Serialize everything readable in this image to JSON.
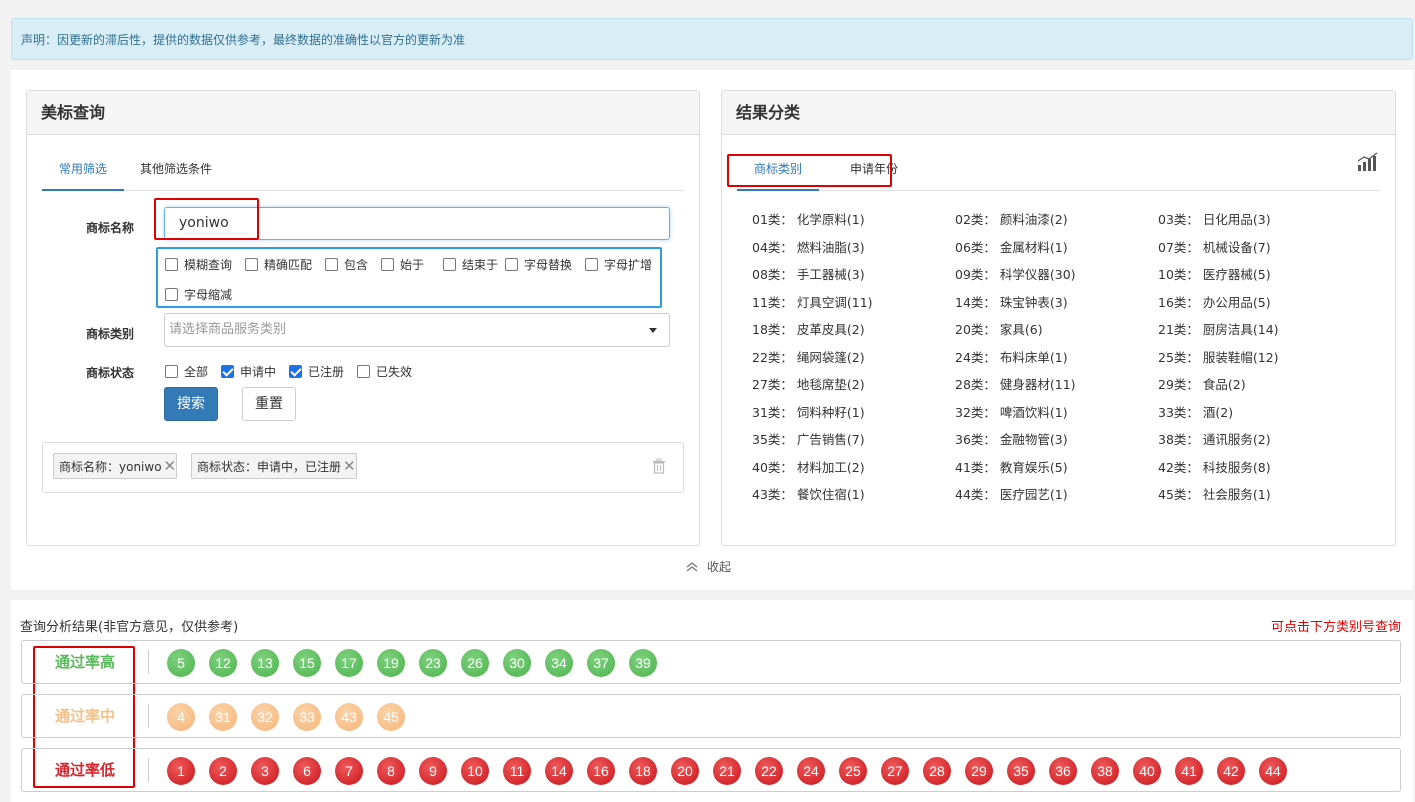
{
  "notice": "声明：因更新的滞后性，提供的数据仅供参考，最终数据的准确性以官方的更新为准",
  "query_panel": {
    "title": "美标查询",
    "tabs": [
      "常用筛选",
      "其他筛选条件"
    ],
    "name_label": "商标名称",
    "name_value": "yoniwo",
    "match_options": [
      {
        "label": "模糊查询",
        "checked": false
      },
      {
        "label": "精确匹配",
        "checked": false
      },
      {
        "label": "包含",
        "checked": false
      },
      {
        "label": "始于",
        "checked": false
      },
      {
        "label": "结束于",
        "checked": false
      },
      {
        "label": "字母替换",
        "checked": false
      },
      {
        "label": "字母扩增",
        "checked": false
      },
      {
        "label": "字母缩减",
        "checked": false
      }
    ],
    "category_label": "商标类别",
    "category_placeholder": "请选择商品服务类别",
    "status_label": "商标状态",
    "status_options": [
      {
        "label": "全部",
        "checked": false
      },
      {
        "label": "申请中",
        "checked": true
      },
      {
        "label": "已注册",
        "checked": true
      },
      {
        "label": "已失效",
        "checked": false
      }
    ],
    "search_button": "搜索",
    "reset_button": "重置",
    "filter_chips": [
      "商标名称：yoniwo",
      "商标状态：申请中，已注册"
    ]
  },
  "result_panel": {
    "title": "结果分类",
    "tabs": [
      "商标类别",
      "申请年份"
    ],
    "classes": [
      "01类： 化学原料(1)",
      "02类： 颜料油漆(2)",
      "03类： 日化用品(3)",
      "04类： 燃料油脂(3)",
      "06类： 金属材料(1)",
      "07类： 机械设备(7)",
      "08类： 手工器械(3)",
      "09类： 科学仪器(30)",
      "10类： 医疗器械(5)",
      "11类： 灯具空调(11)",
      "14类： 珠宝钟表(3)",
      "16类： 办公用品(5)",
      "18类： 皮革皮具(2)",
      "20类： 家具(6)",
      "21类： 厨房洁具(14)",
      "22类： 绳网袋篷(2)",
      "24类： 布料床单(1)",
      "25类： 服装鞋帽(12)",
      "27类： 地毯席垫(2)",
      "28类： 健身器材(11)",
      "29类： 食品(2)",
      "31类： 饲料种籽(1)",
      "32类： 啤酒饮料(1)",
      "33类： 酒(2)",
      "35类： 广告销售(7)",
      "36类： 金融物管(3)",
      "38类： 通讯服务(2)",
      "40类： 材料加工(2)",
      "41类： 教育娱乐(5)",
      "42类： 科技服务(8)",
      "43类： 餐饮住宿(1)",
      "44类： 医疗园艺(1)",
      "45类： 社会服务(1)"
    ]
  },
  "collapse_label": "收起",
  "analysis": {
    "title": "查询分析结果(非官方意见，仅供参考)",
    "hint": "可点击下方类别号查询",
    "rows": [
      {
        "label": "通过率高",
        "level": "high",
        "color": "#5cb85c",
        "classes": [
          "5",
          "12",
          "13",
          "15",
          "17",
          "19",
          "23",
          "26",
          "30",
          "34",
          "37",
          "39"
        ]
      },
      {
        "label": "通过率中",
        "level": "mid",
        "color": "#f5c18a",
        "classes": [
          "4",
          "31",
          "32",
          "33",
          "43",
          "45"
        ]
      },
      {
        "label": "通过率低",
        "level": "low",
        "color": "#d9232b",
        "classes": [
          "1",
          "2",
          "3",
          "6",
          "7",
          "8",
          "9",
          "10",
          "11",
          "14",
          "16",
          "18",
          "20",
          "21",
          "22",
          "24",
          "25",
          "27",
          "28",
          "29",
          "35",
          "36",
          "38",
          "40",
          "41",
          "42",
          "44"
        ]
      }
    ]
  }
}
